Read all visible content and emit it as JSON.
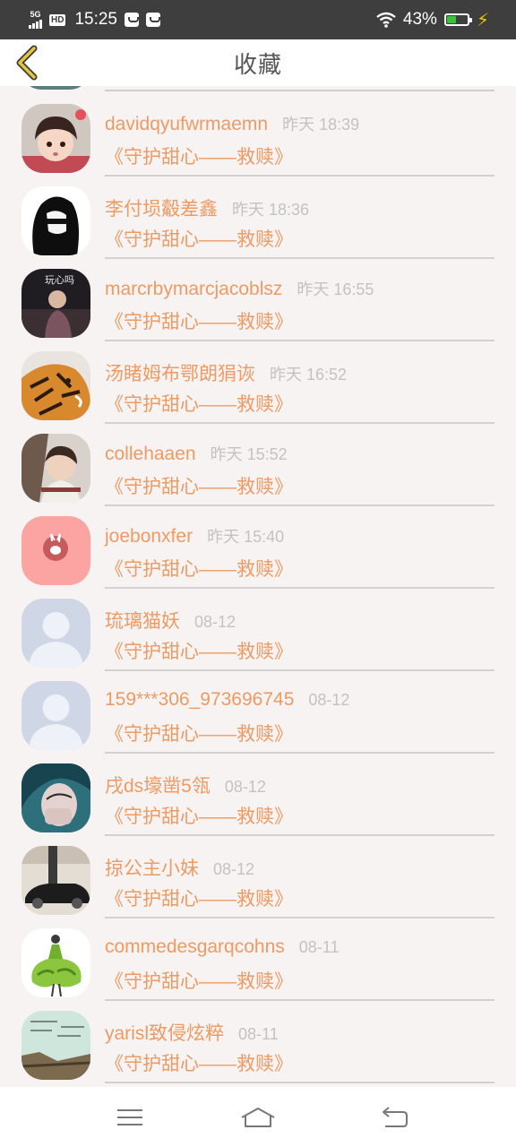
{
  "status": {
    "network": "5G",
    "hd": "HD",
    "time": "15:25",
    "battery_percent": "43%",
    "battery_level": 0.43,
    "battery_fill_color": "#37c43c"
  },
  "header": {
    "title": "收藏"
  },
  "favorites": [
    {
      "name": "davidqyufwrmaemn",
      "time": "昨天 18:39",
      "book": "《守护甜心——救赎》",
      "avatar": "cartoon-boy-avatar"
    },
    {
      "name": "李付埙觳差鑫",
      "time": "昨天 18:36",
      "book": "《守护甜心——救赎》",
      "avatar": "black-white-girl-avatar"
    },
    {
      "name": "marcrbymarcjacoblsz",
      "time": "昨天 16:55",
      "book": "《守护甜心——救赎》",
      "avatar": "dark-photo-avatar"
    },
    {
      "name": "汤睹姆布鄂朗狷诙",
      "time": "昨天 16:52",
      "book": "《守护甜心——救赎》",
      "avatar": "tiger-avatar"
    },
    {
      "name": "collehaaen",
      "time": "昨天 15:52",
      "book": "《守护甜心——救赎》",
      "avatar": "boy-photo-avatar"
    },
    {
      "name": "joebonxfer",
      "time": "昨天 15:40",
      "book": "《守护甜心——救赎》",
      "avatar": "pink-rabbit-avatar"
    },
    {
      "name": "琉璃猫妖",
      "time": "08-12",
      "book": "《守护甜心——救赎》",
      "avatar": "default-user-avatar"
    },
    {
      "name": "159***306_973696745",
      "time": "08-12",
      "book": "《守护甜心——救赎》",
      "avatar": "default-user-avatar"
    },
    {
      "name": "戌ds壕凿5瓴",
      "time": "08-12",
      "book": "《守护甜心——救赎》",
      "avatar": "teal-face-avatar"
    },
    {
      "name": "掠公主小妹",
      "time": "08-12",
      "book": "《守护甜心——救赎》",
      "avatar": "black-car-avatar"
    },
    {
      "name": "commedesgarqcohns",
      "time": "08-11",
      "book": "《守护甜心——救赎》",
      "avatar": "green-dress-avatar"
    },
    {
      "name": "yarisl致侵炫粹",
      "time": "08-11",
      "book": "《守护甜心——救赎》",
      "avatar": "landscape-text-avatar"
    }
  ],
  "nav": {
    "menu_icon": "menu-icon",
    "home_icon": "home-icon",
    "back_icon": "return-icon"
  },
  "colors": {
    "accent": "#ee9a63",
    "time_gray": "#c2c2c2",
    "statusbar": "#3e3e3e",
    "background": "#f7f3f3"
  }
}
